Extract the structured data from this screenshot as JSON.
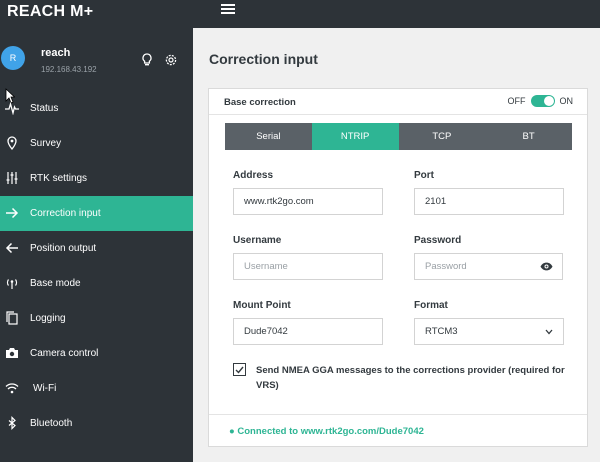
{
  "app": {
    "brand": "REACH M+"
  },
  "user": {
    "initial": "R",
    "name": "reach",
    "ip": "192.168.43.192"
  },
  "nav": [
    {
      "label": "Status",
      "icon": "pulse-icon",
      "active": false
    },
    {
      "label": "Survey",
      "icon": "location-pin-icon",
      "active": false
    },
    {
      "label": "RTK settings",
      "icon": "sliders-icon",
      "active": false
    },
    {
      "label": "Correction input",
      "icon": "arrow-right-icon",
      "active": true
    },
    {
      "label": "Position output",
      "icon": "arrow-left-icon",
      "active": false
    },
    {
      "label": "Base mode",
      "icon": "antenna-icon",
      "active": false
    },
    {
      "label": "Logging",
      "icon": "files-icon",
      "active": false
    },
    {
      "label": "Camera control",
      "icon": "camera-icon",
      "active": false
    },
    {
      "label": "Wi-Fi",
      "icon": "wifi-icon",
      "active": false
    },
    {
      "label": "Bluetooth",
      "icon": "bluetooth-icon",
      "active": false
    }
  ],
  "page": {
    "title": "Correction input"
  },
  "card": {
    "title": "Base correction",
    "toggle_off": "OFF",
    "toggle_on": "ON",
    "tabs": [
      "Serial",
      "NTRIP",
      "TCP",
      "BT"
    ],
    "active_tab": "NTRIP"
  },
  "form": {
    "address_label": "Address",
    "address_value": "www.rtk2go.com",
    "port_label": "Port",
    "port_value": "2101",
    "username_label": "Username",
    "username_placeholder": "Username",
    "password_label": "Password",
    "password_placeholder": "Password",
    "mount_label": "Mount Point",
    "mount_value": "Dude7042",
    "format_label": "Format",
    "format_value": "RTCM3",
    "nmea_label": "Send NMEA GGA messages to the corrections provider (required for VRS)",
    "nmea_checked": true
  },
  "status": {
    "text": "Connected to www.rtk2go.com/Dude7042"
  },
  "colors": {
    "accent": "#2eb594",
    "sidebar": "#2d3338",
    "tabs": "#5a6167",
    "avatar": "#40a3e8"
  }
}
